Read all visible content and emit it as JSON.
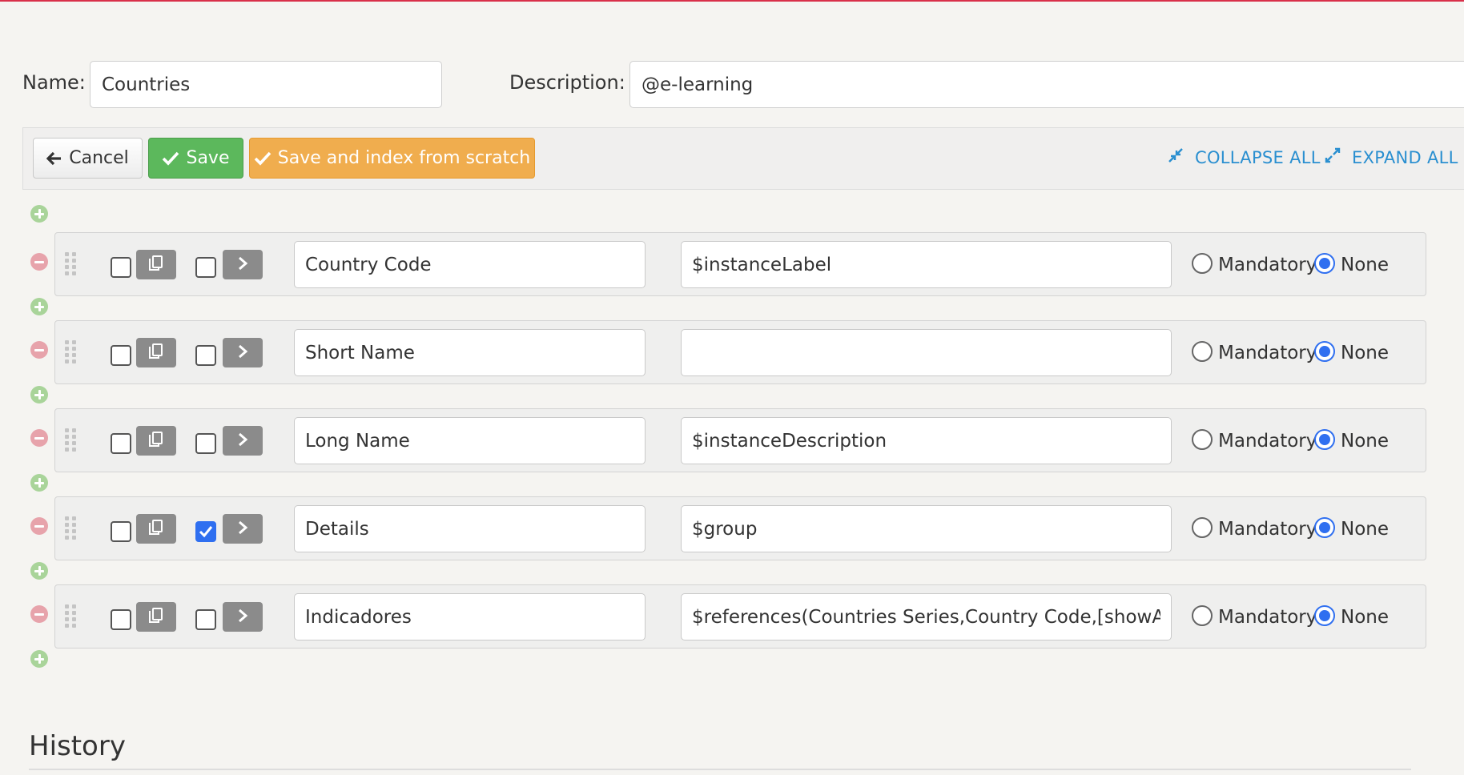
{
  "form": {
    "name_label": "Name:",
    "name_value": "Countries",
    "description_label": "Description:",
    "description_value": "@e-learning"
  },
  "toolbar": {
    "cancel_label": "Cancel",
    "save_label": "Save",
    "save_index_label": "Save and index from scratch",
    "collapse_all_label": "COLLAPSE ALL",
    "expand_all_label": "EXPAND ALL"
  },
  "colors": {
    "accent_blue": "#2a8fd0",
    "save_green": "#5cb85c",
    "index_orange": "#f0ad4e",
    "top_line": "#d9304a"
  },
  "fields": {
    "mandatory_label": "Mandatory",
    "none_label": "None",
    "rows": [
      {
        "name": "Country Code",
        "value": "$instanceLabel",
        "checked_left": false,
        "checked_right": false,
        "requirement": "None"
      },
      {
        "name": "Short Name",
        "value": "",
        "checked_left": false,
        "checked_right": false,
        "requirement": "None"
      },
      {
        "name": "Long Name",
        "value": "$instanceDescription",
        "checked_left": false,
        "checked_right": false,
        "requirement": "None"
      },
      {
        "name": "Details",
        "value": "$group",
        "checked_left": false,
        "checked_right": true,
        "requirement": "None"
      },
      {
        "name": "Indicadores",
        "value": "$references(Countries Series,Country Code,[showActions:edit])",
        "checked_left": false,
        "checked_right": false,
        "requirement": "None"
      }
    ]
  },
  "icons": {
    "cancel": "arrow-left-icon",
    "save": "check-icon",
    "collapse": "compress-icon",
    "expand": "expand-icon",
    "add": "plus-circle-icon",
    "remove": "minus-circle-icon",
    "copy": "copy-icon",
    "open": "chevron-right-icon",
    "drag": "drag-handle-icon"
  },
  "history": {
    "title": "History"
  }
}
